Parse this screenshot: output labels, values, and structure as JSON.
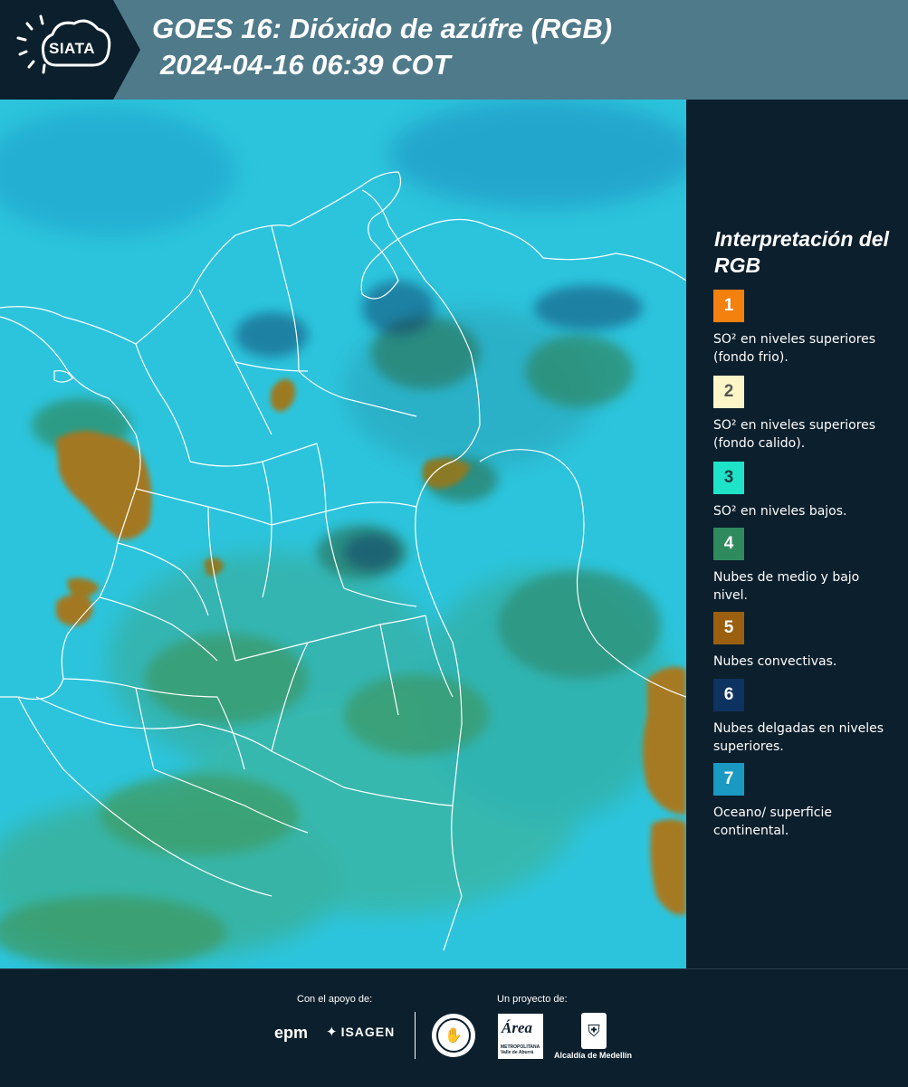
{
  "header": {
    "logo_text": "SIATA",
    "title_line1": "GOES 16: Dióxido de azúfre (RGB)",
    "title_line2": "2024-04-16 06:39 COT"
  },
  "legend": {
    "title": "Interpretación del RGB",
    "items": [
      {
        "number": "1",
        "color": "#f4800e",
        "description": "SO² en niveles superiores (fondo frio)."
      },
      {
        "number": "2",
        "color": "#fcf5c8",
        "description": "SO² en niveles superiores (fondo calido)."
      },
      {
        "number": "3",
        "color": "#1fe3c8",
        "description": "SO² en niveles bajos."
      },
      {
        "number": "4",
        "color": "#2f8a5e",
        "description": "Nubes de medio y bajo nivel."
      },
      {
        "number": "5",
        "color": "#9a6010",
        "description": "Nubes convectivas."
      },
      {
        "number": "6",
        "color": "#0e3360",
        "description": "Nubes delgadas en niveles superiores."
      },
      {
        "number": "7",
        "color": "#1a9ac2",
        "description": "Oceano/ superficie continental."
      }
    ]
  },
  "map": {
    "background_color": "#2cc4dc",
    "border_color": "#ffffff",
    "colors": {
      "low_cloud": "#2f9a62",
      "convective": "#a37820",
      "thin_high": "#0e3360"
    }
  },
  "footer": {
    "support_label": "Con el apoyo de:",
    "project_label": "Un proyecto de:",
    "sponsor1": "epm",
    "sponsor2": "ISAGEN",
    "area_logo_text": "Área",
    "area_logo_sub": "METROPOLITANA Valle de Aburrá",
    "alcaldia": "Alcaldía de Medellín"
  }
}
